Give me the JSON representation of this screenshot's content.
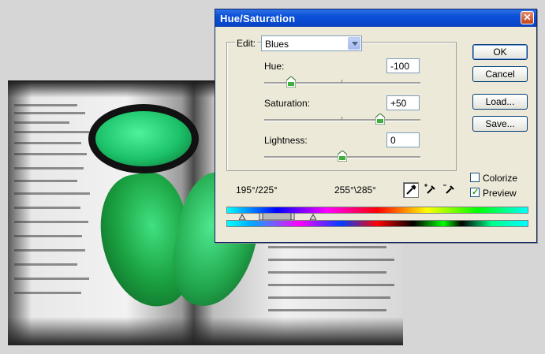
{
  "dialog": {
    "title": "Hue/Saturation",
    "edit_label": "Edit:",
    "edit_value": "Blues",
    "hue": {
      "label": "Hue:",
      "value": "-100",
      "slider_fraction": 0.17
    },
    "saturation": {
      "label": "Saturation:",
      "value": "+50",
      "slider_fraction": 0.74
    },
    "lightness": {
      "label": "Lightness:",
      "value": "0",
      "slider_fraction": 0.5
    },
    "buttons": {
      "ok": "OK",
      "cancel": "Cancel",
      "load": "Load...",
      "save": "Save..."
    },
    "colorize": {
      "label": "Colorize",
      "checked": false
    },
    "preview": {
      "label": "Preview",
      "checked": true
    },
    "range_left": "195°/225°",
    "range_right": "255°\\285°"
  },
  "icons": [
    "close-icon",
    "dropdown-arrow-icon",
    "eyedropper-icon",
    "eyedropper-plus-icon",
    "eyedropper-minus-icon",
    "slider-thumb-icon"
  ]
}
